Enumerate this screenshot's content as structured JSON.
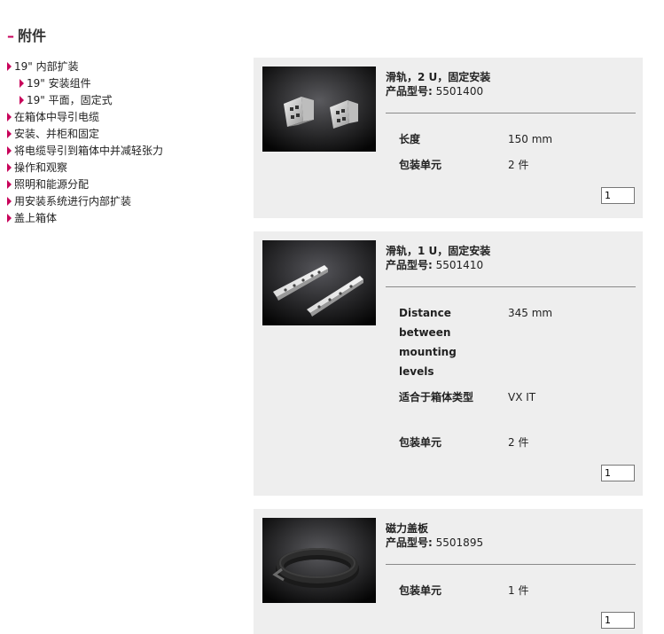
{
  "section": {
    "dash": "–",
    "title": "附件"
  },
  "nav": [
    {
      "label": "19\" 内部扩装"
    },
    {
      "label": "19\" 安装组件"
    },
    {
      "label": "19\" 平面，固定式"
    },
    {
      "label": "在箱体中导引电缆"
    },
    {
      "label": "安装、并柜和固定"
    },
    {
      "label": "将电缆导引到箱体中并减轻张力"
    },
    {
      "label": "操作和观察"
    },
    {
      "label": "照明和能源分配"
    },
    {
      "label": "用安装系统进行内部扩装"
    },
    {
      "label": "盖上箱体"
    }
  ],
  "products": [
    {
      "name": "滑轨，2 U，固定安装",
      "number_label": "产品型号:",
      "number": "5501400",
      "attributes": [
        {
          "label": "长度",
          "value": "150 mm"
        },
        {
          "label": "包装单元",
          "value": "2 件"
        }
      ],
      "qty": "1"
    },
    {
      "name": "滑轨，1 U，固定安装",
      "number_label": "产品型号:",
      "number": "5501410",
      "attributes": [
        {
          "label": "Distance between mounting levels",
          "value": "345 mm"
        },
        {
          "label": "适合于箱体类型",
          "value": "VX IT"
        },
        {
          "label": "包装单元",
          "value": "2 件"
        }
      ],
      "qty": "1"
    },
    {
      "name": "磁力盖板",
      "number_label": "产品型号:",
      "number": "5501895",
      "attributes": [
        {
          "label": "包装单元",
          "value": "1 件"
        }
      ],
      "qty": "1"
    }
  ],
  "colors": {
    "accent": "#c8005a",
    "card_bg": "#eeeeee"
  }
}
